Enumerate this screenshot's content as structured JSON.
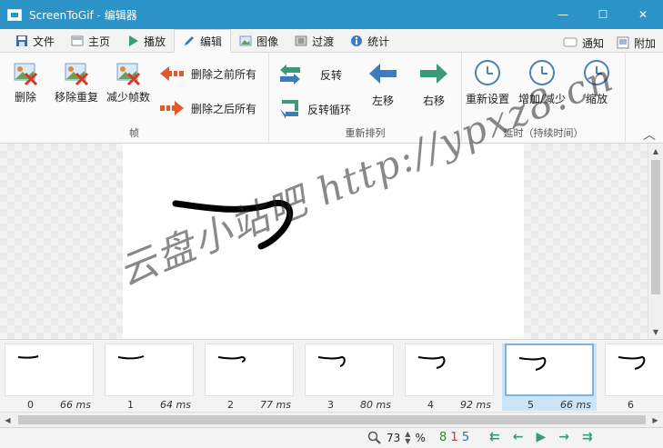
{
  "window": {
    "title": "ScreenToGif - 编辑器",
    "minimize": "—",
    "maximize": "☐",
    "close": "✕"
  },
  "tabs": [
    {
      "label": "文件",
      "icon": "save-icon"
    },
    {
      "label": "主页",
      "icon": "home-icon"
    },
    {
      "label": "播放",
      "icon": "play-icon"
    },
    {
      "label": "编辑",
      "icon": "pencil-icon",
      "active": true
    },
    {
      "label": "图像",
      "icon": "image-icon"
    },
    {
      "label": "过渡",
      "icon": "transition-icon"
    },
    {
      "label": "统计",
      "icon": "info-icon"
    }
  ],
  "tab_right": {
    "notify": "通知",
    "extra": "附加"
  },
  "ribbon": {
    "frames": {
      "label": "帧",
      "delete": "删除",
      "remove_duplicates": "移除重复",
      "reduce_frames": "减少帧数",
      "delete_before": "删除之前所有",
      "delete_after": "删除之后所有"
    },
    "reorder": {
      "label": "重新排列",
      "reverse": "反转",
      "yoyo": "反转循环",
      "move_left": "左移",
      "move_right": "右移"
    },
    "delay": {
      "label": "延时（持续时间）",
      "override": "重新设置",
      "increase_decrease": "增加/减少",
      "scale": "缩放"
    }
  },
  "watermark": "云盘小站吧 http://ypxz8.cn",
  "frames": [
    {
      "num": "0",
      "ms": "66 ms"
    },
    {
      "num": "1",
      "ms": "64 ms"
    },
    {
      "num": "2",
      "ms": "77 ms"
    },
    {
      "num": "3",
      "ms": "80 ms"
    },
    {
      "num": "4",
      "ms": "92 ms"
    },
    {
      "num": "5",
      "ms": "66 ms",
      "selected": true
    },
    {
      "num": "6",
      "ms": ""
    }
  ],
  "status": {
    "zoom": "73",
    "percent": "%",
    "count_total": "8",
    "count_selected": "1",
    "count_current": "5"
  },
  "colors": {
    "titlebar": "#2b93c8",
    "accent_red": "#e05a2b",
    "accent_blue": "#3d7bbf",
    "accent_green": "#3a9a7a"
  }
}
